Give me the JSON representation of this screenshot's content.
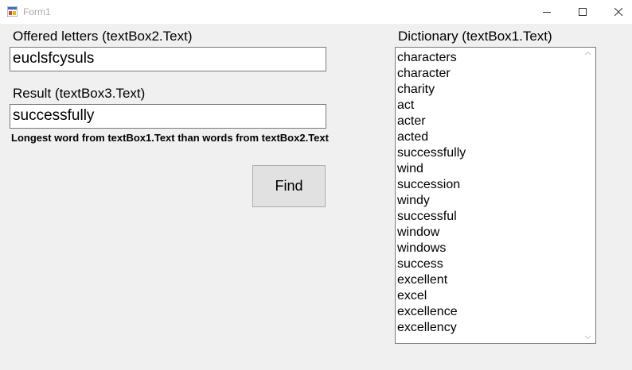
{
  "window": {
    "title": "Form1",
    "icon": "winforms-app-icon",
    "controls": [
      "minimize-icon",
      "maximize-icon",
      "close-icon"
    ]
  },
  "offered": {
    "label": "Offered letters  (textBox2.Text)",
    "value": "euclsfcysuls"
  },
  "result": {
    "label": "Result (textBox3.Text)",
    "value": "successfully",
    "hint": "Longest word from textBox1.Text than words from textBox2.Text"
  },
  "find_button": {
    "label": "Find"
  },
  "dictionary": {
    "label": "Dictionary  (textBox1.Text)",
    "lines": [
      "characters",
      "character",
      "charity",
      "act",
      "acter",
      "acted",
      "successfully",
      "wind",
      "succession",
      "windy",
      "successful",
      "window",
      "windows",
      "success",
      "excellent",
      "excel",
      "excellence",
      "excellency"
    ]
  }
}
